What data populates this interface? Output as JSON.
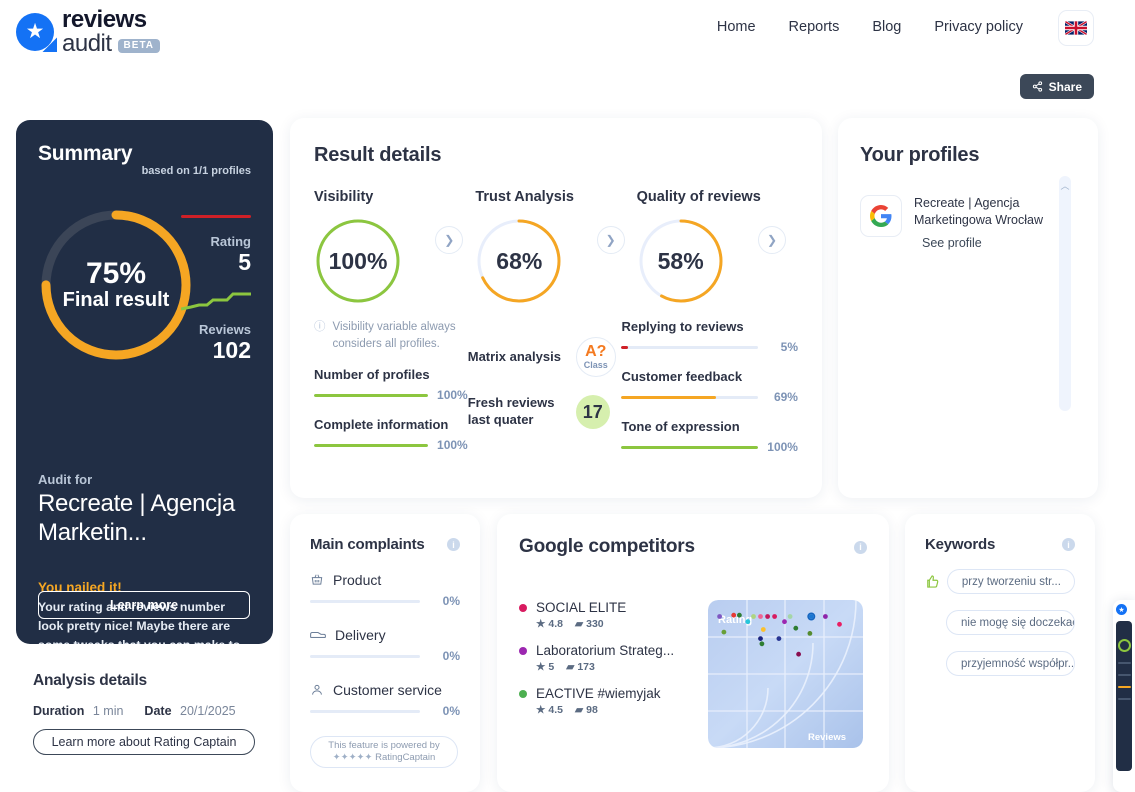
{
  "brand": {
    "line1": "reviews",
    "line2": "audit",
    "beta": "BETA",
    "star_icon": "star-icon"
  },
  "nav": {
    "items": [
      {
        "label": "Home"
      },
      {
        "label": "Reports"
      },
      {
        "label": "Blog"
      },
      {
        "label": "Privacy policy"
      }
    ],
    "language_flag": "uk-flag-icon"
  },
  "share": {
    "label": "Share",
    "icon": "share-icon"
  },
  "summary": {
    "title": "Summary",
    "based_on": "based on 1/1 profiles",
    "donut": {
      "percent": "75%",
      "sublabel": "Final result",
      "value": 75,
      "color": "#f5a623"
    },
    "rating_label": "Rating",
    "rating_value": "5",
    "reviews_label": "Reviews",
    "reviews_value": "102",
    "audit_for_label": "Audit for",
    "audit_name": "Recreate | Agencja Marketin...",
    "callout_title": "You nailed it!",
    "callout_body": "Your rating and reviews number look pretty nice! Maybe there are some tweaks that you can make to be even better! Dig into the analysis below and see what you can upgrade!",
    "learn_more": "Learn more"
  },
  "analysis": {
    "title": "Analysis details",
    "duration_label": "Duration",
    "duration_value": "1 min",
    "date_label": "Date",
    "date_value": "20/1/2025",
    "button": "Learn more about Rating Captain"
  },
  "result": {
    "title": "Result details",
    "gauges": [
      {
        "title": "Visibility",
        "value": "100%",
        "percent": 100,
        "color": "#8cc63f"
      },
      {
        "title": "Trust Analysis",
        "value": "68%",
        "percent": 68,
        "color": "#f5a623"
      },
      {
        "title": "Quality of reviews",
        "value": "58%",
        "percent": 58,
        "color": "#f5a623"
      }
    ],
    "note": "Visibility variable always considers all profiles.",
    "metrics_left": [
      {
        "label": "Number of profiles",
        "value": "100%",
        "percent": 100,
        "color": "#8cc63f"
      },
      {
        "label": "Complete information",
        "value": "100%",
        "percent": 100,
        "color": "#8cc63f"
      }
    ],
    "matrix_label": "Matrix analysis",
    "matrix_grade": "A?",
    "matrix_class": "Class",
    "fresh_label": "Fresh reviews last quater",
    "fresh_value": "17",
    "metrics_right": [
      {
        "label": "Replying to reviews",
        "value": "5%",
        "percent": 5,
        "color": "#cf2027"
      },
      {
        "label": "Customer feedback",
        "value": "69%",
        "percent": 69,
        "color": "#f5a623"
      },
      {
        "label": "Tone of expression",
        "value": "100%",
        "percent": 100,
        "color": "#8cc63f"
      }
    ]
  },
  "profiles": {
    "title": "Your profiles",
    "items": [
      {
        "icon": "google-icon",
        "name": "Recreate | Agencja Marketingowa Wrocław",
        "link": "See profile"
      }
    ]
  },
  "complaints": {
    "title": "Main complaints",
    "info_icon": "info-icon",
    "items": [
      {
        "icon": "basket-icon",
        "label": "Product",
        "value": "0%",
        "percent": 0
      },
      {
        "icon": "truck-icon",
        "label": "Delivery",
        "value": "0%",
        "percent": 0
      },
      {
        "icon": "person-icon",
        "label": "Customer service",
        "value": "0%",
        "percent": 0
      }
    ],
    "powered_line1": "This feature is powered by",
    "powered_line2": "RatingCaptain",
    "powered_stars": "✦✦✦✦✦"
  },
  "competitors": {
    "title": "Google competitors",
    "info_icon": "info-icon",
    "items": [
      {
        "color": "#d81b60",
        "name": "SOCIAL ELITE",
        "rating": "4.8",
        "reviews": "330"
      },
      {
        "color": "#9c27b0",
        "name": "Laboratorium Strateg...",
        "rating": "5",
        "reviews": "173"
      },
      {
        "color": "#4caf50",
        "name": "EACTIVE #wiemyjak",
        "rating": "4.5",
        "reviews": "98"
      }
    ],
    "chart_data": {
      "type": "scatter",
      "title": "",
      "xlabel": "Reviews",
      "ylabel": "Rating",
      "xlim": [
        0,
        100
      ],
      "ylim": [
        0,
        100
      ],
      "grid": true,
      "points": [
        {
          "x": 4,
          "y": 95,
          "color": "#7e57c2"
        },
        {
          "x": 14,
          "y": 96,
          "color": "#e53935"
        },
        {
          "x": 18,
          "y": 96,
          "color": "#2e7d32"
        },
        {
          "x": 28,
          "y": 95,
          "color": "#aed581"
        },
        {
          "x": 33,
          "y": 95,
          "color": "#f06292"
        },
        {
          "x": 38,
          "y": 95,
          "color": "#c2185b"
        },
        {
          "x": 43,
          "y": 95,
          "color": "#d81b60"
        },
        {
          "x": 24,
          "y": 91,
          "color": "#26c6da"
        },
        {
          "x": 50,
          "y": 91,
          "color": "#9c27b0"
        },
        {
          "x": 54,
          "y": 95,
          "color": "#a5d6a7"
        },
        {
          "x": 69,
          "y": 95,
          "color": "#1976d2"
        },
        {
          "x": 79,
          "y": 95,
          "color": "#8e24aa"
        },
        {
          "x": 89,
          "y": 89,
          "color": "#e91e63"
        },
        {
          "x": 35,
          "y": 85,
          "color": "#fbc02d"
        },
        {
          "x": 58,
          "y": 86,
          "color": "#2e7d32"
        },
        {
          "x": 68,
          "y": 82,
          "color": "#558b2f"
        },
        {
          "x": 7,
          "y": 83,
          "color": "#689f38"
        },
        {
          "x": 33,
          "y": 78,
          "color": "#1a237e"
        },
        {
          "x": 46,
          "y": 78,
          "color": "#283593"
        },
        {
          "x": 34,
          "y": 74,
          "color": "#2e7d32"
        },
        {
          "x": 60,
          "y": 66,
          "color": "#880e4f"
        }
      ]
    }
  },
  "keywords": {
    "title": "Keywords",
    "info_icon": "info-icon",
    "thumb_icon": "thumbs-up-icon",
    "items": [
      {
        "label": "przy tworzeniu str...",
        "has_thumb": true
      },
      {
        "label": "nie mogę się doczekać",
        "has_thumb": false
      },
      {
        "label": "przyjemność współpr...",
        "has_thumb": false
      }
    ]
  }
}
